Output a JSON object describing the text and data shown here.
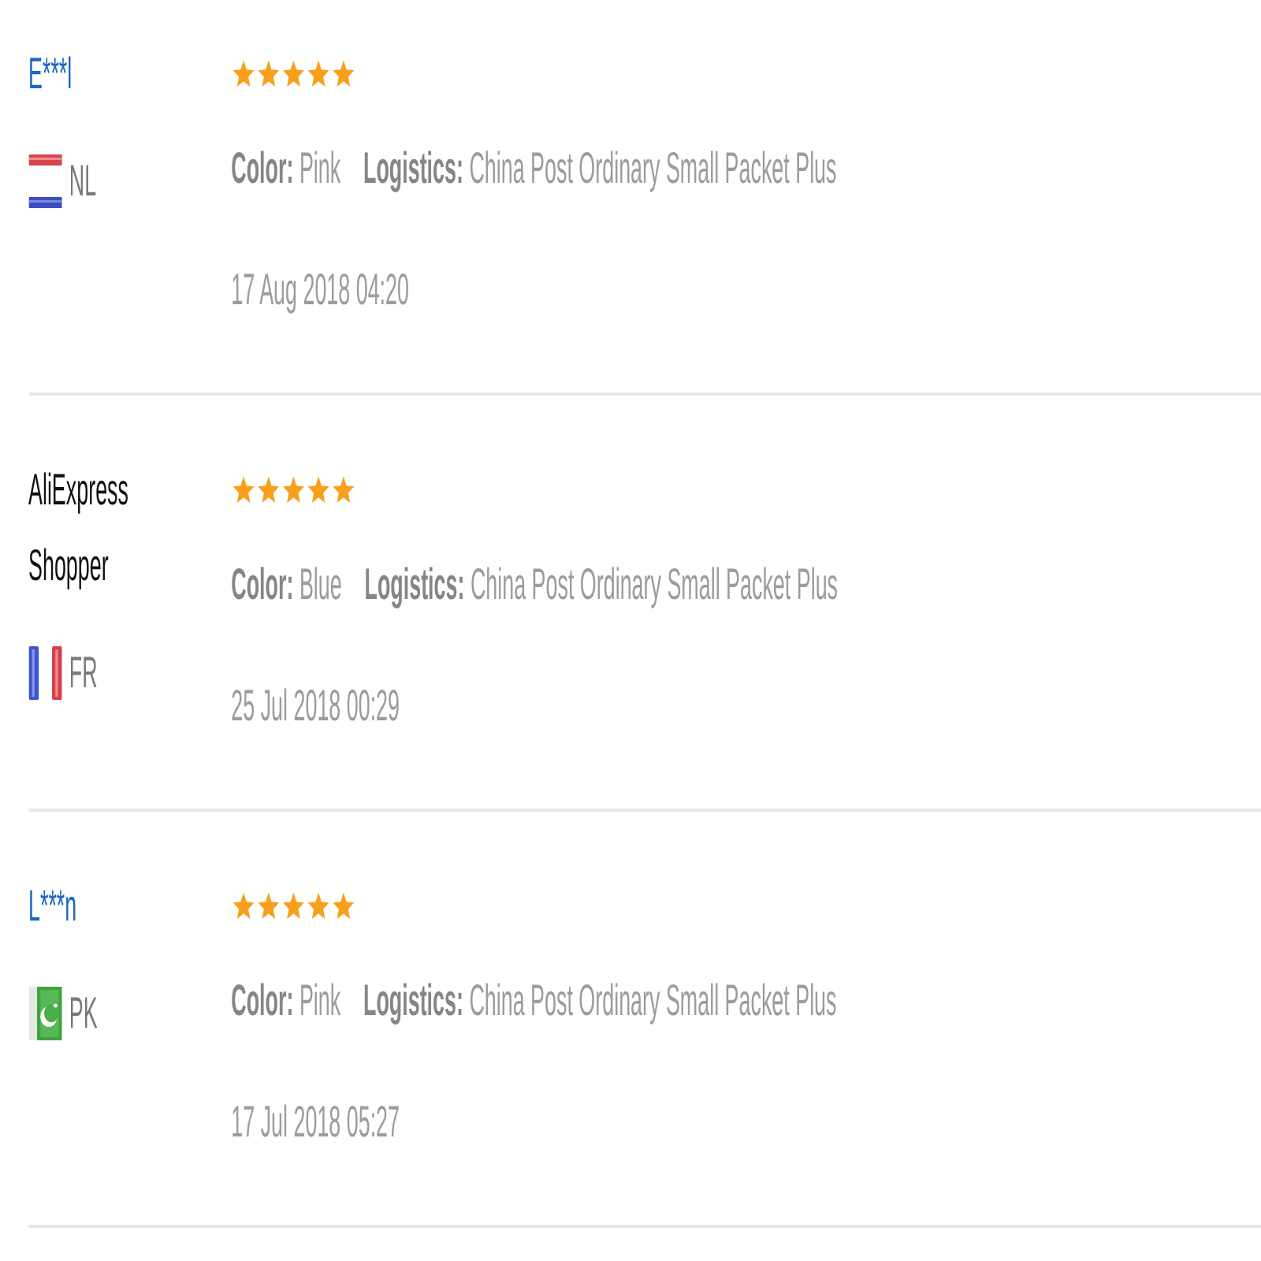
{
  "reviews": [
    {
      "reviewer": {
        "name": "E***l",
        "kind": "member"
      },
      "country": {
        "code": "NL",
        "kind": "netherlands"
      },
      "stars": 5,
      "details": [
        {
          "label": "Color:",
          "value": "Pink"
        },
        {
          "label": "Logistics:",
          "value": "China Post Ordinary Small Packet Plus"
        }
      ],
      "date": "17 Aug 2018 04:20"
    },
    {
      "reviewer": {
        "name": "AliExpress Shopper",
        "kind": "guest"
      },
      "country": {
        "code": "FR",
        "kind": "france"
      },
      "stars": 5,
      "details": [
        {
          "label": "Color:",
          "value": "Blue"
        },
        {
          "label": "Logistics:",
          "value": "China Post Ordinary Small Packet Plus"
        }
      ],
      "date": "25 Jul 2018 00:29"
    },
    {
      "reviewer": {
        "name": "L***n",
        "kind": "member"
      },
      "country": {
        "code": "PK",
        "kind": "pakistan"
      },
      "stars": 5,
      "details": [
        {
          "label": "Color:",
          "value": "Pink"
        },
        {
          "label": "Logistics:",
          "value": "China Post Ordinary Small Packet Plus"
        }
      ],
      "date": "17 Jul 2018 05:27"
    }
  ]
}
